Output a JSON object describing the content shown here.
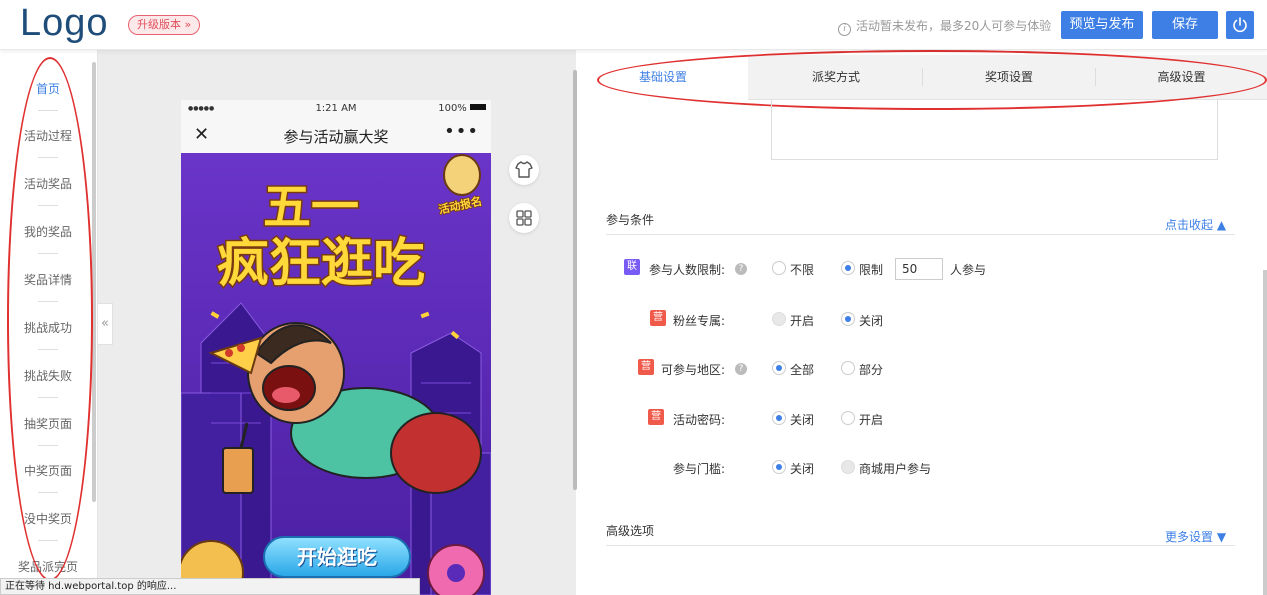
{
  "header": {
    "logo": "Logo",
    "upgrade_label": "升级版本 »",
    "notice_icon": "info-icon",
    "notice_text": "活动暂未发布，最多20人可参与体验",
    "preview_publish_label": "预览与发布",
    "save_label": "保存",
    "power_icon": "power-icon"
  },
  "sidebar": {
    "items": [
      {
        "label": "首页"
      },
      {
        "label": "活动过程"
      },
      {
        "label": "活动奖品"
      },
      {
        "label": "我的奖品"
      },
      {
        "label": "奖品详情"
      },
      {
        "label": "挑战成功"
      },
      {
        "label": "挑战失败"
      },
      {
        "label": "抽奖页面"
      },
      {
        "label": "中奖页面"
      },
      {
        "label": "没中奖页"
      },
      {
        "label": "奖品派完页"
      }
    ],
    "collapse_glyph": "«"
  },
  "phone": {
    "status_dots": "●●●●●",
    "time": "1:21 AM",
    "battery": "100%",
    "close_glyph": "✕",
    "title": "参与活动赢大奖",
    "more_glyph": "•••",
    "poster": {
      "headline_line1": "五一",
      "headline_line2": "疯狂逛吃",
      "tag": "活动报名",
      "start_button": "开始逛吃"
    }
  },
  "tools": {
    "theme_icon": "shirt-icon",
    "layout_icon": "grid-icon"
  },
  "tabs": [
    {
      "label": "基础设置"
    },
    {
      "label": "派奖方式"
    },
    {
      "label": "奖项设置"
    },
    {
      "label": "高级设置"
    }
  ],
  "conditions": {
    "title": "参与条件",
    "toggle_label": "点击收起 ▲",
    "rows": [
      {
        "badge": "联",
        "label": "参与人数限制:",
        "options": [
          "不限",
          "限制"
        ],
        "input_value": "50",
        "suffix": "人参与"
      },
      {
        "badge": "营",
        "label": "粉丝专属:",
        "options": [
          "开启",
          "关闭"
        ]
      },
      {
        "badge": "营",
        "label": "可参与地区:",
        "options": [
          "全部",
          "部分"
        ]
      },
      {
        "badge": "营",
        "label": "活动密码:",
        "options": [
          "关闭",
          "开启"
        ]
      },
      {
        "label": "参与门槛:",
        "options": [
          "关闭",
          "商城用户参与"
        ]
      }
    ]
  },
  "advanced": {
    "title": "高级选项",
    "more_label": "更多设置 ▼"
  },
  "browser_status": "正在等待 hd.webportal.top 的响应..."
}
